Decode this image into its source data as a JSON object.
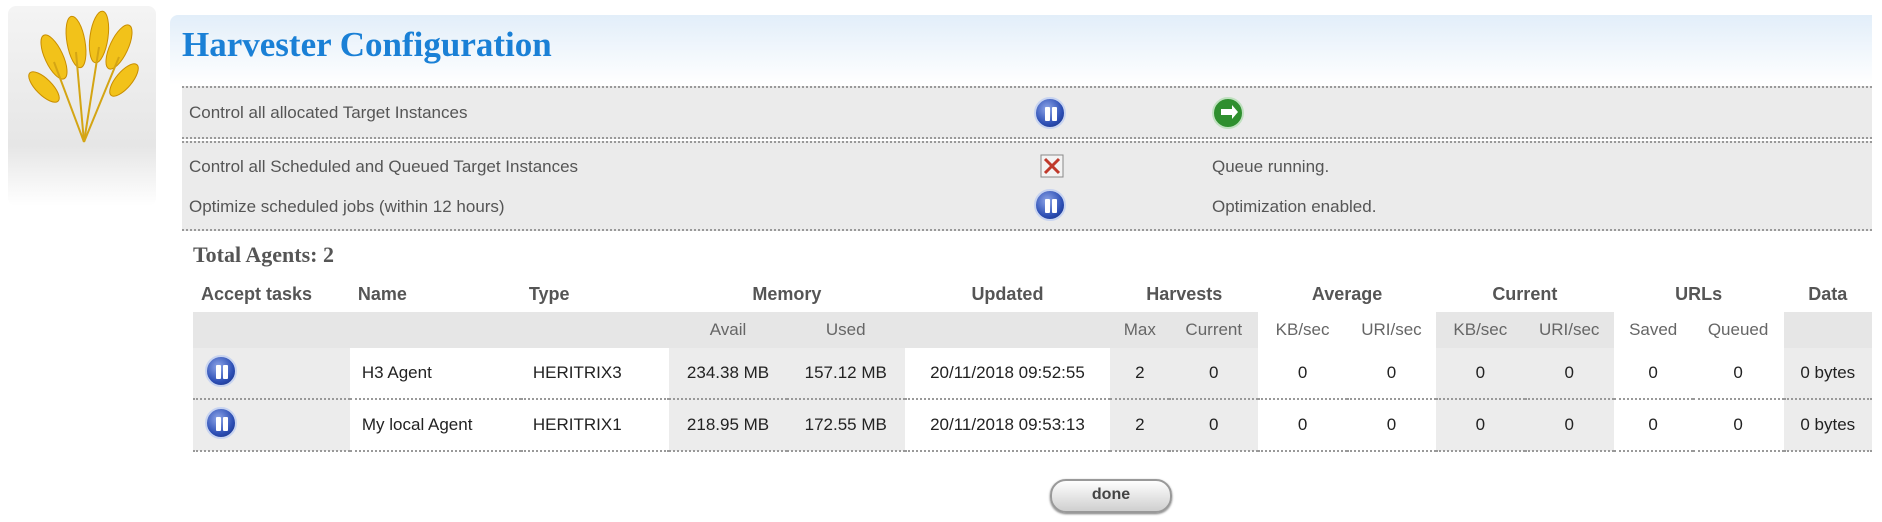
{
  "header": {
    "title": "Harvester Configuration"
  },
  "controls": [
    {
      "label": "Control all allocated Target Instances",
      "icon": "pause-icon",
      "icon2": "resume-icon"
    },
    {
      "label": "Control all Scheduled and Queued Target Instances",
      "icon": "stop-queue-icon",
      "status": "Queue running."
    },
    {
      "label": "Optimize scheduled jobs (within 12 hours)",
      "icon": "pause-icon",
      "status": "Optimization enabled."
    }
  ],
  "agents": {
    "total_label": "Total Agents: 2",
    "group_headers": {
      "accept_tasks": "Accept tasks",
      "name": "Name",
      "type": "Type",
      "memory": "Memory",
      "updated": "Updated",
      "harvests": "Harvests",
      "average": "Average",
      "current": "Current",
      "urls": "URLs",
      "data": "Data"
    },
    "sub_headers": {
      "avail": "Avail",
      "used": "Used",
      "max": "Max",
      "current": "Current",
      "avg_kb": "KB/sec",
      "avg_uri": "URI/sec",
      "cur_kb": "KB/sec",
      "cur_uri": "URI/sec",
      "saved": "Saved",
      "queued": "Queued"
    },
    "rows": [
      {
        "name": "H3 Agent",
        "type": "HERITRIX3",
        "avail": "234.38 MB",
        "used": "157.12 MB",
        "updated": "20/11/2018 09:52:55",
        "max": "2",
        "current": "0",
        "avg_kb": "0",
        "avg_uri": "0",
        "cur_kb": "0",
        "cur_uri": "0",
        "saved": "0",
        "queued": "0",
        "data": "0 bytes"
      },
      {
        "name": "My local Agent",
        "type": "HERITRIX1",
        "avail": "218.95 MB",
        "used": "172.55 MB",
        "updated": "20/11/2018 09:53:13",
        "max": "2",
        "current": "0",
        "avg_kb": "0",
        "avg_uri": "0",
        "cur_kb": "0",
        "cur_uri": "0",
        "saved": "0",
        "queued": "0",
        "data": "0 bytes"
      }
    ]
  },
  "buttons": {
    "done": "done"
  },
  "colors": {
    "title": "#1a80d6",
    "panel": "#ebebeb"
  }
}
